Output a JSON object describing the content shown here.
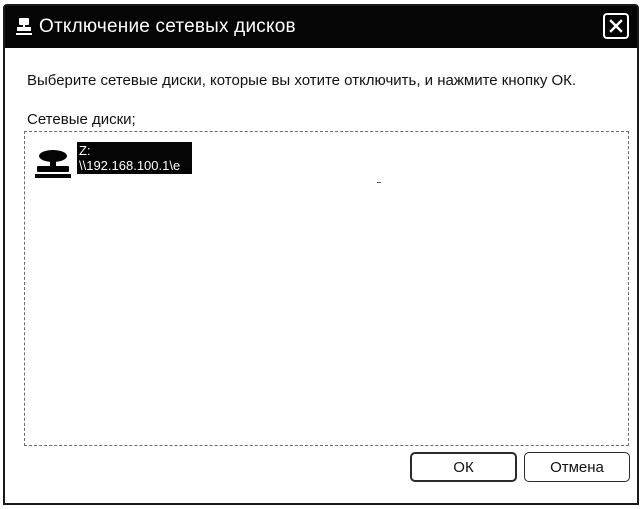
{
  "window": {
    "title": "Отключение сетевых дисков"
  },
  "dialog": {
    "instruction": "Выберите сетевые диски, которые вы хотите отключить, и нажмите кнопку ОК.",
    "list_label": "Сетевые диски;",
    "items": [
      {
        "drive": "Z:",
        "path": "\\\\192.168.100.1\\e",
        "selected": true,
        "icon": "network-drive-icon"
      }
    ]
  },
  "buttons": {
    "ok": "ОК",
    "cancel": "Отмена"
  },
  "colors": {
    "titlebar": "#050505",
    "selection": "#050505",
    "background": "#ffffff"
  }
}
